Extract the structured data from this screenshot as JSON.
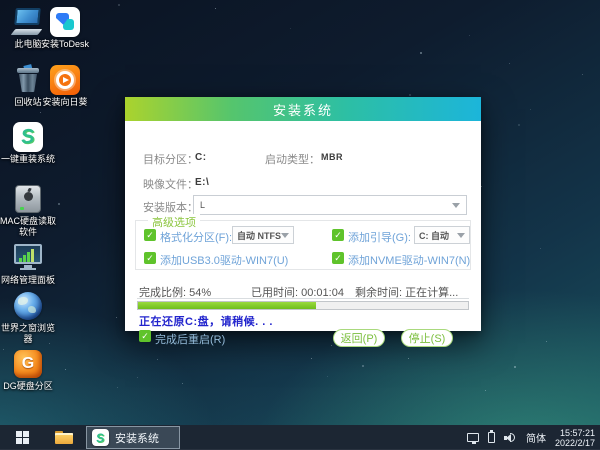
{
  "desktop": {
    "icons": [
      {
        "name": "this-pc",
        "label": "此电脑"
      },
      {
        "name": "todesk",
        "label": "安装ToDesk"
      },
      {
        "name": "recycle-bin",
        "label": "回收站"
      },
      {
        "name": "sunflower",
        "label": "安装向日葵"
      },
      {
        "name": "reinstall",
        "label": "一键重装系统"
      },
      {
        "name": "mac-disk",
        "label": "MAC硬盘读取软件"
      },
      {
        "name": "network-panel",
        "label": "网络管理面板"
      },
      {
        "name": "browser",
        "label": "世界之窗浏览器"
      },
      {
        "name": "diskgenius",
        "label": "DG硬盘分区"
      }
    ]
  },
  "dialog": {
    "title": "安装系统",
    "fields": {
      "target_label": "目标分区：",
      "target_value": "C:",
      "boot_label": "启动类型：",
      "boot_value": "MBR",
      "image_label": "映像文件：",
      "image_value": "E:\\",
      "version_label": "安装版本：",
      "version_value": "L"
    },
    "advanced": {
      "group_label": "高级选项",
      "format_label": "格式化分区(F):",
      "format_value": "自动 NTFS",
      "addboot_label": "添加引导(G):",
      "addboot_value": "C: 自动",
      "usb_label": "添加USB3.0驱动-WIN7(U)",
      "nvme_label": "添加NVME驱动-WIN7(N)"
    },
    "progress": {
      "percent": 54,
      "percent_text": "完成比例: 54%",
      "elapsed_text": "已用时间: 00:01:04",
      "remaining_text": "剩余时间: 正在计算...",
      "status_text": "正在还原C:盘，请稍候. . ."
    },
    "footer": {
      "restart_label": "完成后重启(R)",
      "back_button": "返回(P)",
      "stop_button": "停止(S)"
    }
  },
  "taskbar": {
    "task_label": "安装系统",
    "tray": {
      "ime": "简体",
      "time": "15:57:21",
      "date": "2022/2/17"
    }
  },
  "colors": {
    "title_gradient_start": "#abd32d",
    "title_gradient_end": "#1cb5da",
    "progress_fill": "#6fbe1d",
    "accent_green": "#7cbf3f",
    "status_blue": "#2224cd",
    "checkbox_green": "#5fc32b",
    "taskbar_bg": "#1c2633"
  }
}
